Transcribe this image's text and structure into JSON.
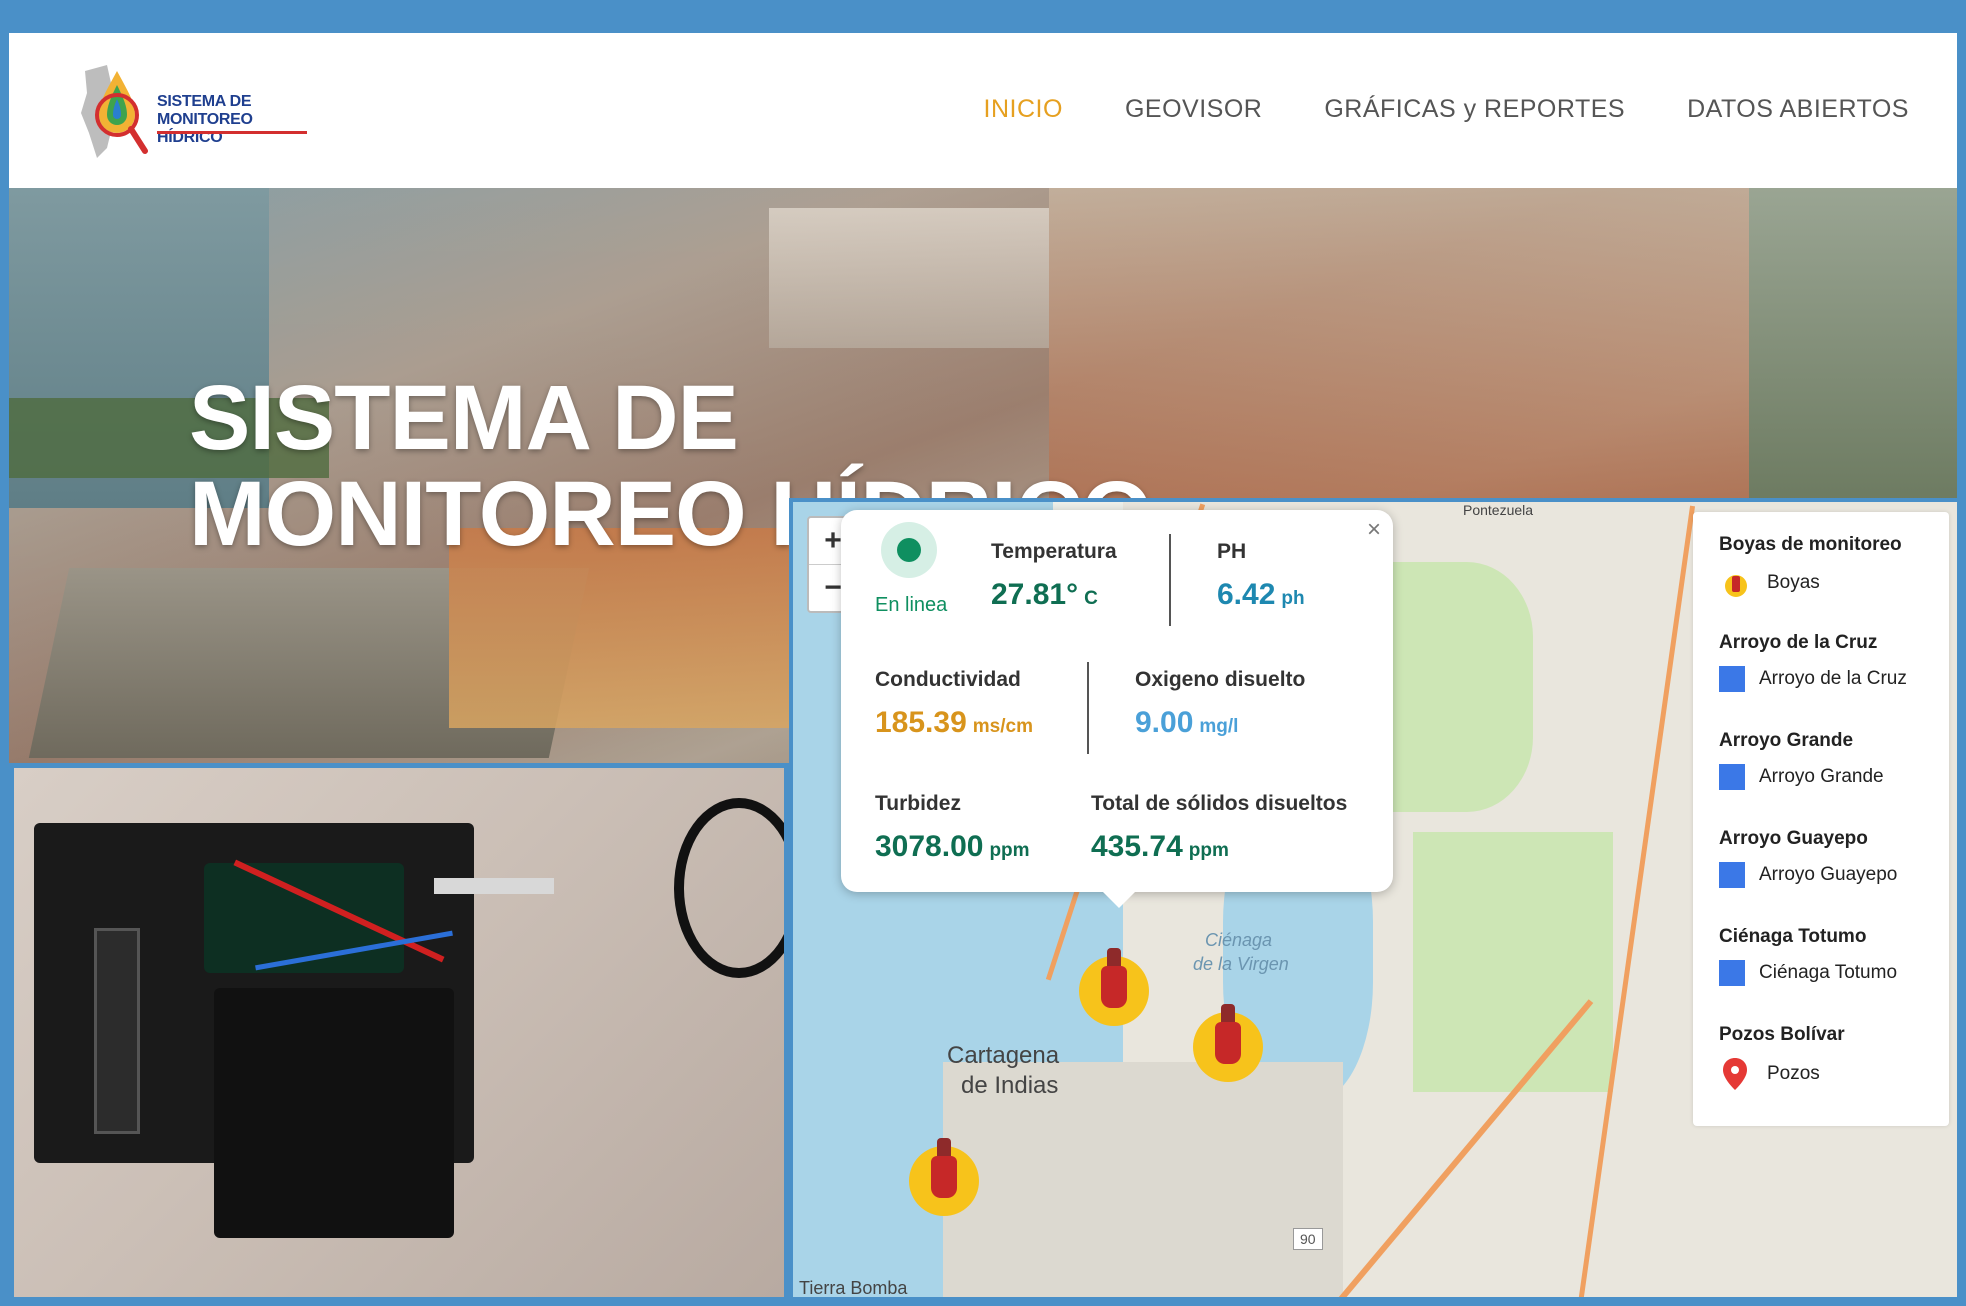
{
  "brand": {
    "logo_line1": "SISTEMA DE",
    "logo_line2": "MONITOREO HÍDRICO"
  },
  "nav": [
    {
      "label": "INICIO",
      "active": true
    },
    {
      "label": "GEOVISOR",
      "active": false
    },
    {
      "label": "GRÁFICAS y REPORTES",
      "active": false
    },
    {
      "label": "DATOS ABIERTOS",
      "active": false
    }
  ],
  "hero": {
    "title_line1": "SISTEMA DE",
    "title_line2": "MONITOREO HÍDRICO"
  },
  "map": {
    "zoom_in": "+",
    "zoom_out": "−",
    "labels": {
      "cartagena_1": "Cartagena",
      "cartagena_2": "de Indias",
      "cienaga_1": "Ciénaga",
      "cienaga_2": "de la Virgen",
      "tierra_bomba": "Tierra Bomba",
      "pontezuela": "Pontezuela",
      "route": "90"
    },
    "popup": {
      "close": "×",
      "status": "En linea",
      "status_color": "#0f8f60",
      "temperature": {
        "label": "Temperatura",
        "value": "27.81°",
        "unit": "C",
        "color": "#0f6e52"
      },
      "ph": {
        "label": "PH",
        "value": "6.42",
        "unit": "ph",
        "color": "#1e88b0"
      },
      "conductivity": {
        "label": "Conductividad",
        "value": "185.39",
        "unit": "ms/cm",
        "color": "#d8941c"
      },
      "oxygen": {
        "label": "Oxigeno disuelto",
        "value": "9.00",
        "unit": "mg/l",
        "color": "#4aa0d8"
      },
      "turbidity": {
        "label": "Turbidez",
        "value": "3078.00",
        "unit": "ppm",
        "color": "#0f6e52"
      },
      "tds": {
        "label": "Total de sólidos disueltos",
        "value": "435.74",
        "unit": "ppm",
        "color": "#0f6e52"
      }
    },
    "legend": {
      "groups": [
        {
          "title": "Boyas de monitoreo",
          "item": "Boyas",
          "icon": "buoy-icon"
        },
        {
          "title": "Arroyo de la Cruz",
          "item": "Arroyo de la Cruz",
          "icon": "blue-square-icon"
        },
        {
          "title": "Arroyo Grande",
          "item": "Arroyo Grande",
          "icon": "blue-square-icon"
        },
        {
          "title": "Arroyo Guayepo",
          "item": "Arroyo Guayepo",
          "icon": "blue-square-icon"
        },
        {
          "title": "Ciénaga Totumo",
          "item": "Ciénaga Totumo",
          "icon": "blue-square-icon"
        },
        {
          "title": "Pozos Bolívar",
          "item": "Pozos",
          "icon": "map-pin-icon"
        }
      ]
    }
  }
}
